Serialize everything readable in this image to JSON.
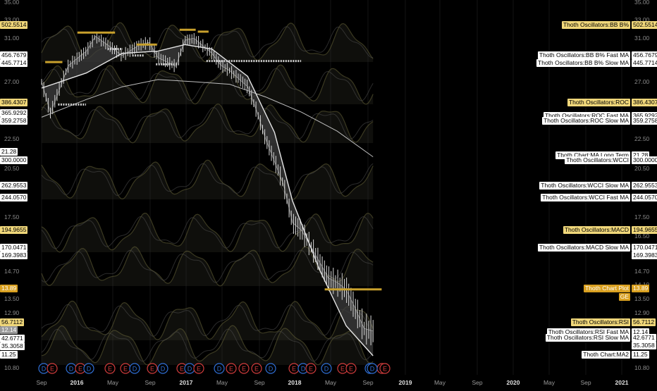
{
  "chart_data": {
    "type": "line",
    "title": "",
    "xlabel": "",
    "ylabel": "",
    "x_ticks": [
      "Sep",
      "2016",
      "May",
      "Sep",
      "2017",
      "May",
      "Sep",
      "2018",
      "May",
      "Sep",
      "2019",
      "May",
      "Sep",
      "2020",
      "May",
      "Sep",
      "2021"
    ],
    "x_ticks_bold": [
      "2016",
      "2017",
      "2018",
      "2019",
      "2020",
      "2021"
    ],
    "y_ticks_right": [
      "35.00",
      "33.00",
      "31.00",
      "27.00",
      "22.50",
      "20.50",
      "17.50",
      "16.50",
      "14.70",
      "14.10",
      "13.50",
      "12.90",
      "11.25",
      "10.80"
    ],
    "y_ticks_left": [
      "35.00",
      "33.00",
      "31.00",
      "27.00",
      "22.50",
      "20.50",
      "17.50",
      "14.70",
      "13.50",
      "12.90",
      "10.80"
    ],
    "price_series": {
      "name": "Thoth Chart Plot",
      "x": [
        "2015-09",
        "2015-10",
        "2015-12",
        "2016-02",
        "2016-03",
        "2016-05",
        "2016-06",
        "2016-08",
        "2016-09",
        "2016-10",
        "2016-12",
        "2017-01",
        "2017-02",
        "2017-04",
        "2017-05",
        "2017-06",
        "2017-08",
        "2017-09",
        "2017-10",
        "2017-12",
        "2018-01",
        "2018-02",
        "2018-04",
        "2018-05",
        "2018-06",
        "2018-07",
        "2018-08",
        "2018-09",
        "2018-10"
      ],
      "y": [
        27.0,
        24.5,
        28.5,
        29.8,
        31.2,
        30.0,
        29.4,
        30.4,
        30.6,
        29.2,
        28.4,
        30.8,
        31.0,
        29.6,
        28.5,
        28.0,
        26.6,
        24.7,
        22.5,
        19.5,
        17.2,
        16.8,
        15.2,
        14.4,
        14.2,
        13.9,
        13.1,
        12.3,
        12.2
      ]
    },
    "ma_long_term": {
      "name": "Thoth Chart:MA Long Term",
      "x": [
        "2015-09",
        "2016-02",
        "2016-06",
        "2016-10",
        "2017-02",
        "2017-06",
        "2017-10",
        "2018-02",
        "2018-06",
        "2018-10"
      ],
      "y": [
        24.2,
        25.6,
        26.6,
        27.2,
        27.0,
        26.8,
        25.8,
        24.6,
        23.1,
        21.28
      ]
    },
    "ma2": {
      "name": "Thoth Chart:MA2",
      "x": [
        "2015-09",
        "2016-02",
        "2016-06",
        "2016-10",
        "2017-01",
        "2017-04",
        "2017-08",
        "2017-11",
        "2018-01",
        "2018-04",
        "2018-07",
        "2018-10"
      ],
      "y": [
        26.5,
        27.8,
        29.6,
        29.8,
        30.4,
        30.0,
        27.5,
        23.0,
        18.5,
        14.8,
        12.4,
        11.25
      ]
    },
    "oscillators": [
      {
        "name": "Thoth Oscillators:BB B%",
        "last": "502.5514"
      },
      {
        "name": "Thoth Oscillators:BB B% Fast MA",
        "last": "456.7679"
      },
      {
        "name": "Thoth Oscillators:BB B% Slow MA",
        "last": "445.7714"
      },
      {
        "name": "Thoth Oscillators:ROC",
        "last": "386.4307"
      },
      {
        "name": "Thoth Oscillators:ROC Fast MA",
        "last": "365.9292"
      },
      {
        "name": "Thoth Oscillators:ROC Slow MA",
        "last": "359.2758"
      },
      {
        "name": "Thoth Oscillators:WCCI",
        "last": "300.0000"
      },
      {
        "name": "Thoth Oscillators:WCCI Slow MA",
        "last": "262.9553"
      },
      {
        "name": "Thoth Oscillators:WCCI Fast MA",
        "last": "244.0570"
      },
      {
        "name": "Thoth Oscillators:MACD",
        "last": "194.9655"
      },
      {
        "name": "Thoth Oscillators:MACD Slow MA",
        "last": "170.0471"
      },
      {
        "name": "Thoth Oscillators:RSI",
        "last": "56.7112"
      },
      {
        "name": "Thoth Oscillators:RSI Fast MA",
        "last": "42.6771"
      },
      {
        "name": "Thoth Oscillators:RSI Slow MA",
        "last": "35.3058"
      }
    ],
    "event_markers": [
      "D",
      "E",
      "D",
      "E",
      "D",
      "E",
      "E",
      "D",
      "E",
      "D",
      "E",
      "D",
      "E",
      "D",
      "E",
      "E",
      "E",
      "D",
      "E",
      "D",
      "E",
      "D",
      "E",
      "E",
      "D",
      "E",
      "D",
      "E"
    ],
    "colors": {
      "background": "#000000",
      "price": "#d8d8d8",
      "ma_long": "#bdbdbd",
      "ma2": "#e6e6e6",
      "gold": "#c8a02c",
      "oscillator": "#6e6a3a",
      "dividend": "#2f6fd6",
      "earnings": "#d23c3c"
    }
  },
  "left_price_tags": [
    {
      "text": "502.5514",
      "style": "gold"
    },
    {
      "text": "456.7679",
      "style": "white"
    },
    {
      "text": "445.7714",
      "style": "white"
    },
    {
      "text": "386.4307",
      "style": "gold"
    },
    {
      "text": "365.9292",
      "style": "white"
    },
    {
      "text": "359.2758",
      "style": "white"
    },
    {
      "text": "21.28",
      "style": "white"
    },
    {
      "text": "300.0000",
      "style": "white"
    },
    {
      "text": "262.9553",
      "style": "white"
    },
    {
      "text": "244.0570",
      "style": "white"
    },
    {
      "text": "194.9655",
      "style": "gold"
    },
    {
      "text": "170.0471",
      "style": "white"
    },
    {
      "text": "169.3983",
      "style": "white"
    },
    {
      "text": "13.89",
      "style": "amber"
    },
    {
      "text": "56.7112",
      "style": "gold"
    },
    {
      "text": "12.14",
      "style": "grey"
    },
    {
      "text": "42.6771",
      "style": "white"
    },
    {
      "text": "35.3058",
      "style": "white"
    },
    {
      "text": "11.25",
      "style": "white"
    }
  ],
  "right_labels": [
    {
      "name": "Thoth Oscillators:BB B%",
      "value": "502.5514",
      "style": "gold"
    },
    {
      "name": "Thoth Oscillators:BB B% Fast MA",
      "value": "456.7679",
      "style": "white"
    },
    {
      "name": "Thoth Oscillators:BB B% Slow MA",
      "value": "445.7714",
      "style": "white"
    },
    {
      "name": "Thoth Oscillators:ROC",
      "value": "386.4307",
      "style": "gold"
    },
    {
      "name": "Thoth Oscillators:ROC Fast MA",
      "value": "365.9292",
      "style": "white"
    },
    {
      "name": "Thoth Oscillators:ROC Slow MA",
      "value": "359.2758",
      "style": "white"
    },
    {
      "name": "Thoth Chart:MA Long Term",
      "value": "21.28",
      "style": "white"
    },
    {
      "name": "Thoth Oscillators:WCCI",
      "value": "300.0000",
      "style": "white"
    },
    {
      "name": "Thoth Oscillators:WCCI Slow MA",
      "value": "262.9553",
      "style": "white"
    },
    {
      "name": "Thoth Oscillators:WCCI Fast MA",
      "value": "244.0570",
      "style": "white"
    },
    {
      "name": "Thoth Oscillators:MACD",
      "value": "194.9655",
      "style": "gold"
    },
    {
      "name": "Thoth Oscillators:MACD Slow MA",
      "value": "170.0471",
      "style": "white"
    },
    {
      "name": "",
      "value": "169.3983",
      "style": "white"
    },
    {
      "name": "Thoth Chart Plot",
      "value": "13.89",
      "style": "amber"
    },
    {
      "name": "GE",
      "value": "",
      "style": "amber"
    },
    {
      "name": "Thoth Oscillators:RSI",
      "value": "56.7112",
      "style": "gold"
    },
    {
      "name": "Thoth Oscillators:RSI Fast MA",
      "value": "12.14",
      "style": "white"
    },
    {
      "name": "Thoth Oscillators:RSI Slow MA",
      "value": "42.6771",
      "style": "white"
    },
    {
      "name": "",
      "value": "35.3058",
      "style": "white"
    },
    {
      "name": "Thoth Chart:MA2",
      "value": "11.25",
      "style": "white"
    }
  ]
}
